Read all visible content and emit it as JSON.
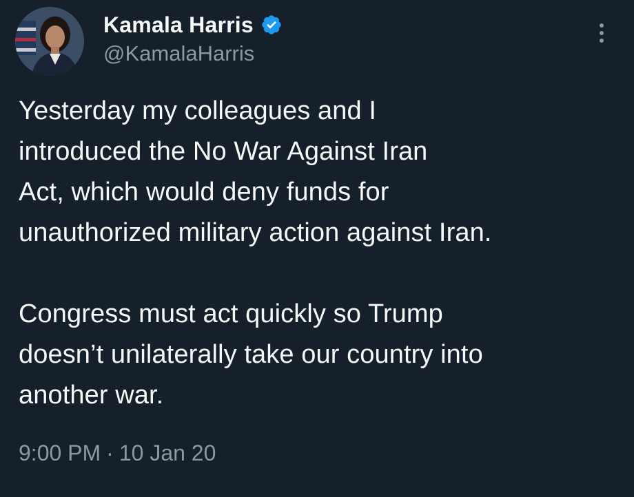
{
  "author": {
    "display_name": "Kamala Harris",
    "handle": "@KamalaHarris",
    "verified": true
  },
  "tweet": {
    "paragraphs": [
      "Yesterday my colleagues and I\nintroduced the No War Against Iran\nAct, which would deny funds for\nunauthorized military action against Iran.",
      "Congress must act quickly so Trump\ndoesn’t unilaterally take our country into\nanother war."
    ],
    "time": "9:00 PM",
    "separator": "·",
    "date": "10 Jan 20"
  },
  "icons": {
    "verified": "verified-badge-icon",
    "more": "more-options-icon"
  },
  "colors": {
    "background": "#15202b",
    "text": "#f7f9f9",
    "secondary_text": "#8b98a5",
    "verified_badge": "#1d9bf0"
  }
}
